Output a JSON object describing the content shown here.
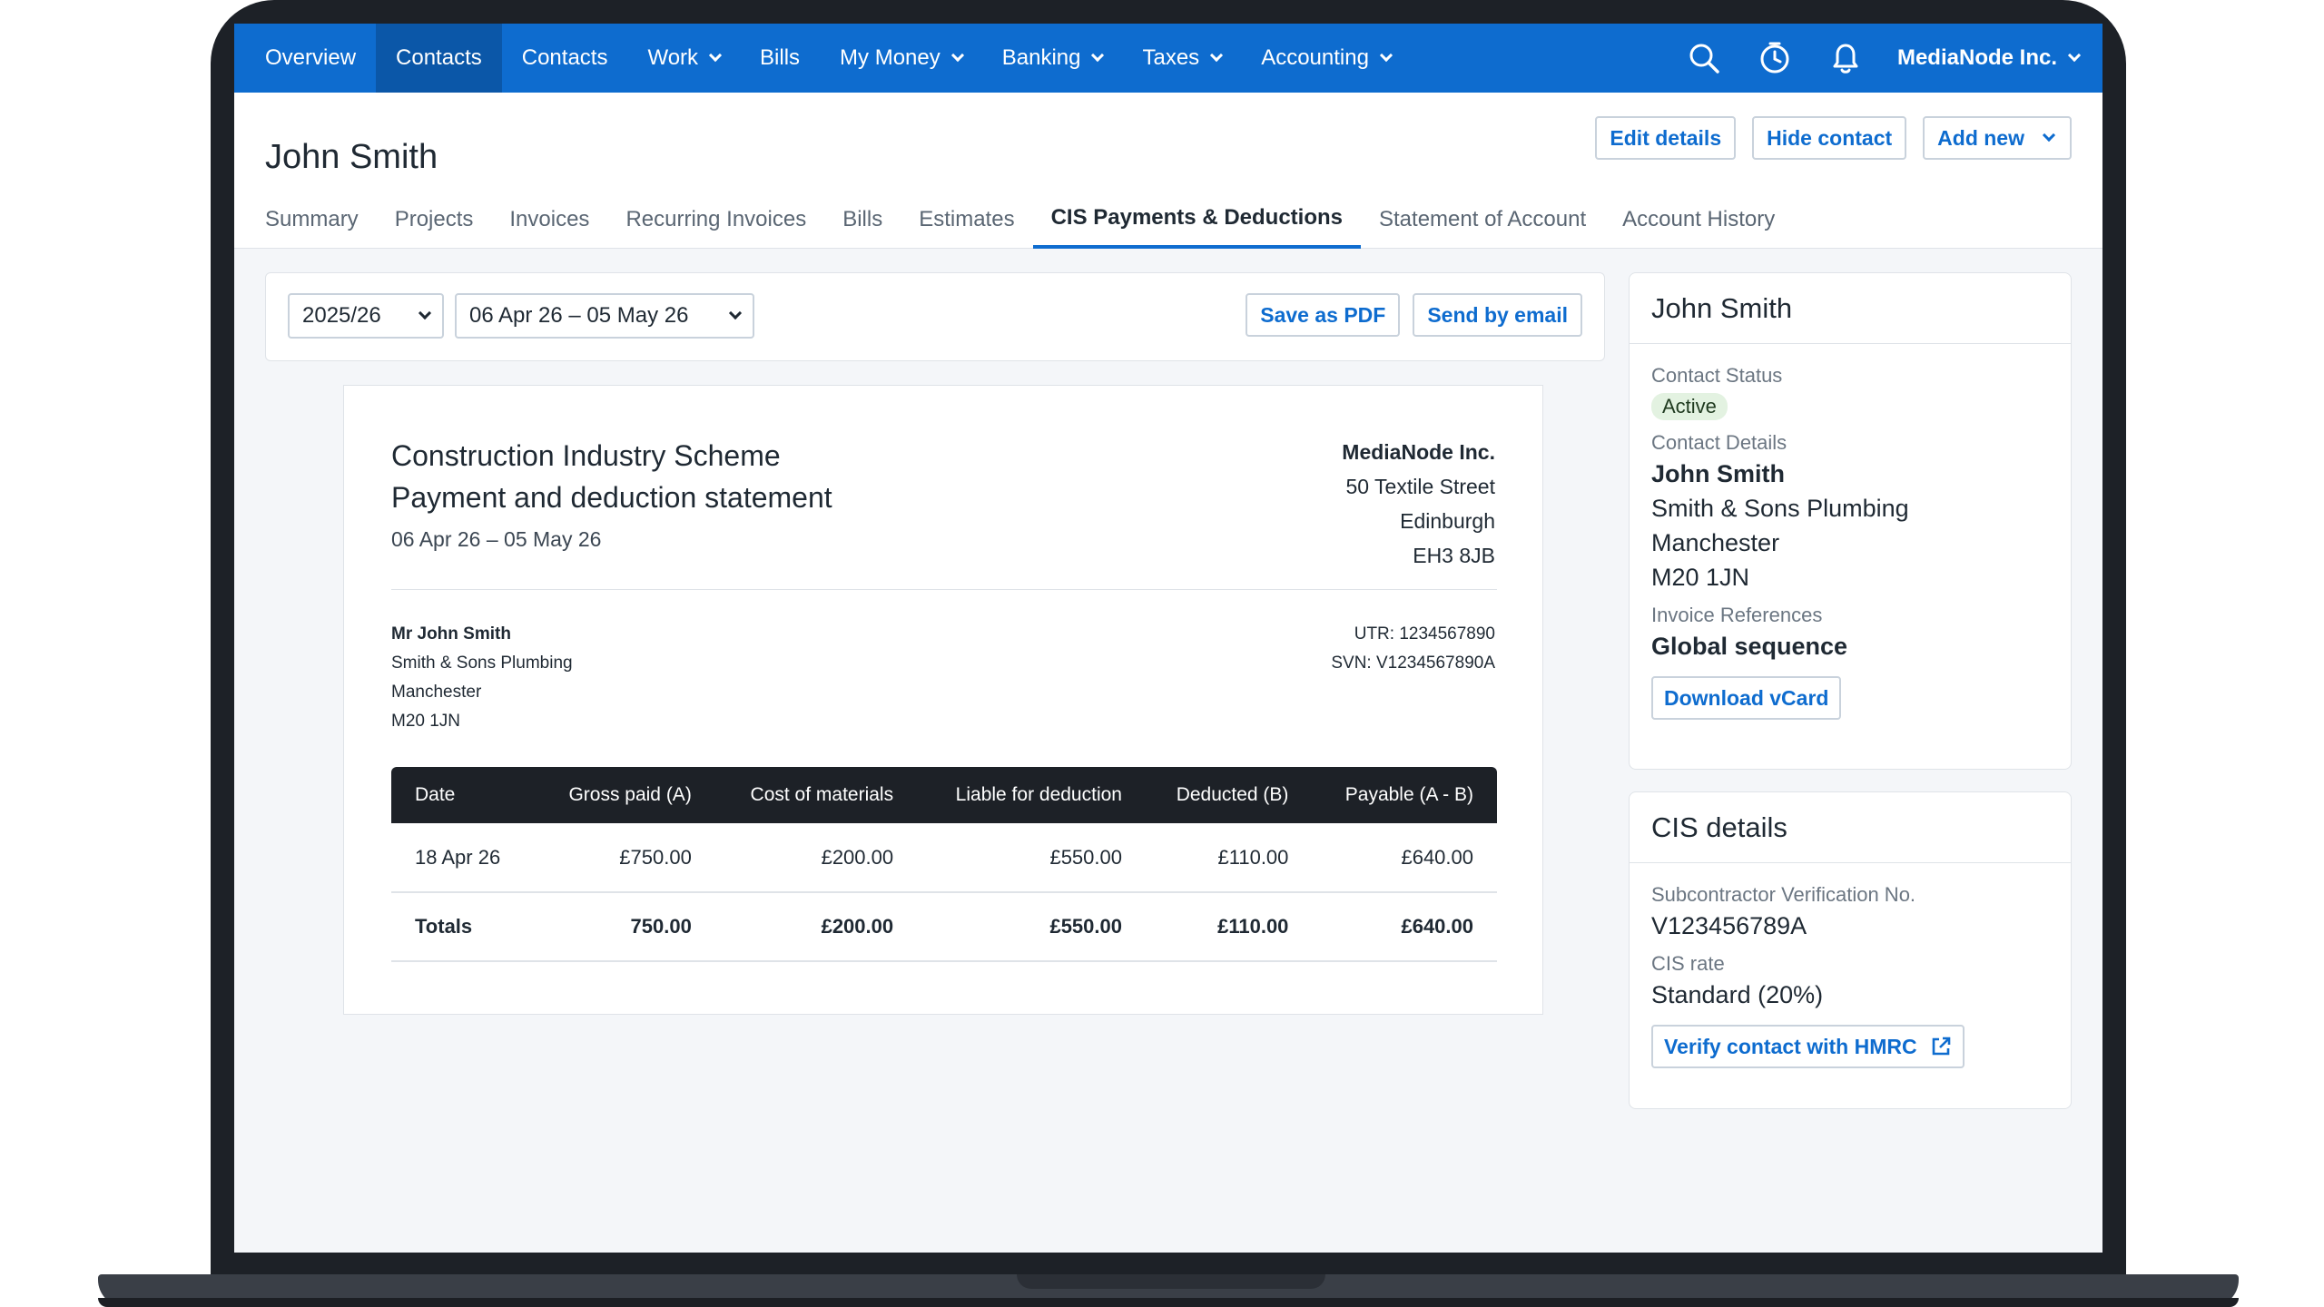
{
  "nav": {
    "items": [
      {
        "label": "Overview",
        "has_menu": false
      },
      {
        "label": "Contacts",
        "has_menu": false,
        "active": true
      },
      {
        "label": "Contacts",
        "has_menu": false
      },
      {
        "label": "Work",
        "has_menu": true
      },
      {
        "label": "Bills",
        "has_menu": false
      },
      {
        "label": "My Money",
        "has_menu": true
      },
      {
        "label": "Banking",
        "has_menu": true
      },
      {
        "label": "Taxes",
        "has_menu": true
      },
      {
        "label": "Accounting",
        "has_menu": true
      }
    ],
    "company": "MediaNode Inc.",
    "icons": [
      "search-icon",
      "timer-icon",
      "bell-icon"
    ]
  },
  "header": {
    "title": "John Smith",
    "actions": {
      "edit": "Edit details",
      "hide": "Hide contact",
      "add_new": "Add new"
    },
    "tabs": [
      {
        "label": "Summary"
      },
      {
        "label": "Projects"
      },
      {
        "label": "Invoices"
      },
      {
        "label": "Recurring Invoices"
      },
      {
        "label": "Bills"
      },
      {
        "label": "Estimates"
      },
      {
        "label": "CIS Payments & Deductions",
        "active": true
      },
      {
        "label": "Statement of Account"
      },
      {
        "label": "Account History"
      }
    ]
  },
  "filters": {
    "tax_year": "2025/26",
    "period": "06 Apr 26 – 05 May 26",
    "save_pdf": "Save as PDF",
    "send_email": "Send by email"
  },
  "statement": {
    "title_line1": "Construction Industry Scheme",
    "title_line2": "Payment and deduction statement",
    "period": "06 Apr 26 – 05 May 26",
    "company": {
      "name": "MediaNode Inc.",
      "street": "50 Textile Street",
      "city": "Edinburgh",
      "postcode": "EH3 8JB"
    },
    "recipient": {
      "name": "Mr John Smith",
      "company": "Smith & Sons Plumbing",
      "city": "Manchester",
      "postcode": "M20 1JN"
    },
    "utr": "UTR: 1234567890",
    "svn": "SVN: V1234567890A",
    "table": {
      "headers": [
        "Date",
        "Gross paid (A)",
        "Cost of materials",
        "Liable for deduction",
        "Deducted (B)",
        "Payable (A - B)"
      ],
      "rows": [
        [
          "18 Apr 26",
          "£750.00",
          "£200.00",
          "£550.00",
          "£110.00",
          "£640.00"
        ]
      ],
      "totals": [
        "Totals",
        "750.00",
        "£200.00",
        "£550.00",
        "£110.00",
        "£640.00"
      ]
    }
  },
  "contact_card": {
    "title": "John Smith",
    "status_label": "Contact Status",
    "status": "Active",
    "details_label": "Contact Details",
    "details_name": "John Smith",
    "details_company": "Smith & Sons Plumbing",
    "details_city": "Manchester",
    "details_postcode": "M20 1JN",
    "refs_label": "Invoice References",
    "refs_value": "Global sequence",
    "vcard": "Download vCard"
  },
  "cis_card": {
    "title": "CIS details",
    "svn_label": "Subcontractor Verification No.",
    "svn_value": "V123456789A",
    "rate_label": "CIS rate",
    "rate_value": "Standard (20%)",
    "verify": "Verify contact with HMRC"
  },
  "colors": {
    "brand": "#0e6ccf",
    "nav_active": "#0b57a8",
    "table_header": "#1d2127",
    "badge_bg": "#e3f2e1"
  }
}
